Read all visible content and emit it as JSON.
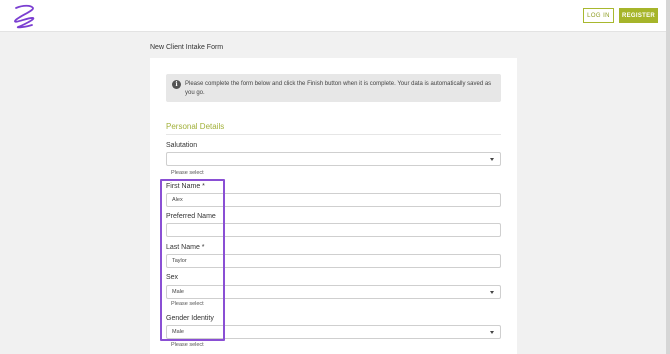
{
  "header": {
    "logo_icon": "scribble-logo-icon",
    "login_label": "LOG IN",
    "register_label": "REGISTER",
    "accent_color": "#a6b52a"
  },
  "page": {
    "title": "New Client Intake Form"
  },
  "notice": {
    "icon": "info-icon",
    "icon_glyph": "i",
    "text": "Please complete the form below and click the Finish button when it is complete. Your data is automatically saved as you go."
  },
  "section": {
    "title": "Personal Details"
  },
  "fields": {
    "salutation": {
      "label": "Salutation",
      "value": "",
      "hint": "Please select"
    },
    "first_name": {
      "label": "First Name *",
      "value": "Alex"
    },
    "preferred_name": {
      "label": "Preferred Name",
      "value": ""
    },
    "last_name": {
      "label": "Last Name *",
      "value": "Taylor"
    },
    "sex": {
      "label": "Sex",
      "value": "Male",
      "hint": "Please select"
    },
    "gender_identity": {
      "label": "Gender Identity",
      "value": "Male",
      "hint": "Please select"
    }
  },
  "highlight_color": "#8a4fd4"
}
